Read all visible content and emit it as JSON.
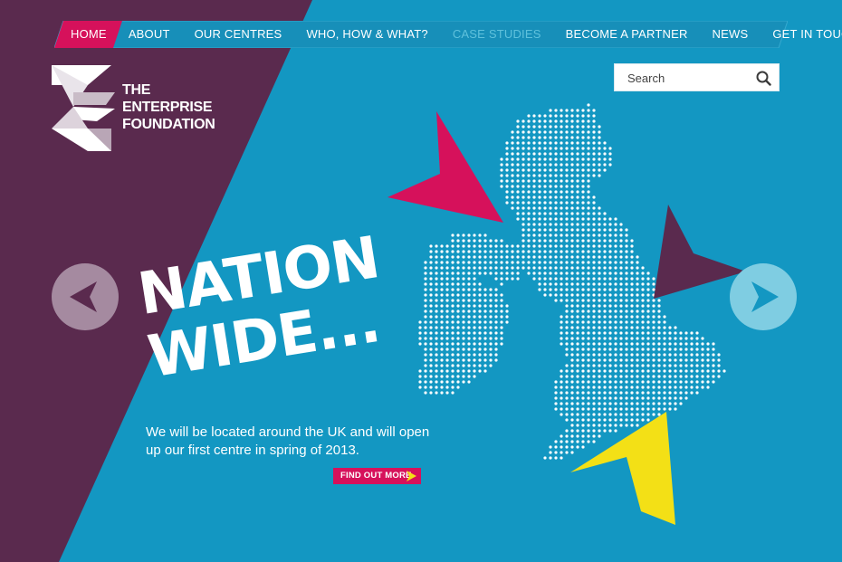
{
  "nav": {
    "items": [
      {
        "label": "HOME",
        "state": "active"
      },
      {
        "label": "ABOUT",
        "state": "normal"
      },
      {
        "label": "OUR CENTRES",
        "state": "normal"
      },
      {
        "label": "WHO, HOW & WHAT?",
        "state": "normal"
      },
      {
        "label": "CASE STUDIES",
        "state": "muted"
      },
      {
        "label": "BECOME A PARTNER",
        "state": "normal"
      },
      {
        "label": "NEWS",
        "state": "normal"
      },
      {
        "label": "GET IN TOUCH",
        "state": "normal"
      }
    ]
  },
  "logo": {
    "line1": "THE ENTERPRISE",
    "line2": "FOUNDATION"
  },
  "search": {
    "placeholder": "Search",
    "icon": "search-icon"
  },
  "hero": {
    "headline_line1": "NATION",
    "headline_line2": "WIDE...",
    "subcopy": "We will be located around the UK and will open up our first centre in spring of 2013.",
    "cta_label": "FIND OUT MORE"
  },
  "carousel": {
    "prev_icon": "chevron-left-icon",
    "next_icon": "chevron-right-icon"
  },
  "colors": {
    "background": "#1397c2",
    "purple": "#5a2a4e",
    "accent_pink": "#d6115b",
    "accent_yellow": "#f3e016",
    "muted_nav": "#5fc1dc"
  }
}
